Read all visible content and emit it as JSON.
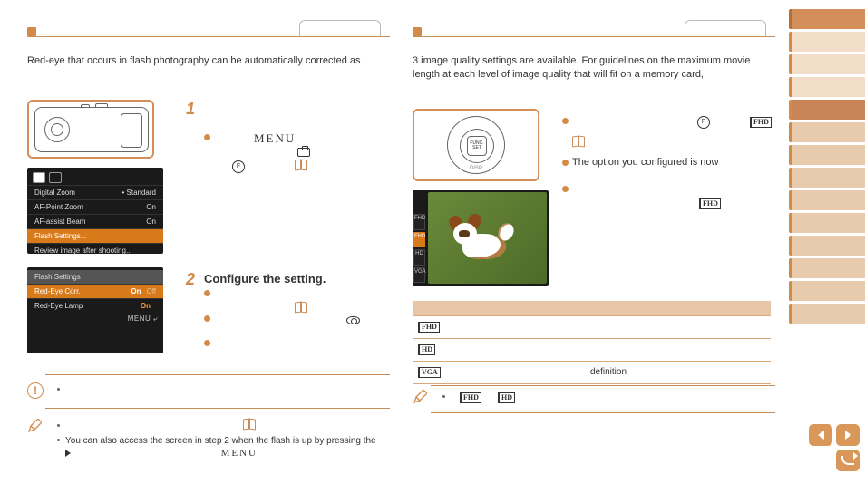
{
  "left": {
    "intro": "Red-eye that occurs in flash photography can be automatically corrected as",
    "menu_label": "MENU",
    "screen1": {
      "rows": [
        {
          "label": "Digital Zoom",
          "value": "• Standard"
        },
        {
          "label": "AF-Point Zoom",
          "value": "On"
        },
        {
          "label": "AF-assist Beam",
          "value": "On"
        },
        {
          "label": "Flash Settings...",
          "value": ""
        },
        {
          "label": "Review image after shooting...",
          "value": ""
        }
      ],
      "selected": 3
    },
    "screen2": {
      "title": "Flash Settings",
      "rows": [
        {
          "label": "Red-Eye Corr.",
          "on": "On",
          "off": "Off"
        },
        {
          "label": "Red-Eye Lamp",
          "on": "On",
          "off": ""
        }
      ],
      "selected": 0,
      "footer": "MENU ⤶"
    },
    "step2_heading": "Configure the setting.",
    "caution_mark": "!",
    "note_text": "You can also access the screen in step 2 when the flash is up by pressing the",
    "note_menu": "MENU"
  },
  "right": {
    "intro": "3 image quality settings are available. For guidelines on the maximum movie length at each level of image quality that will fit on a memory card,",
    "dial": {
      "top": "",
      "bottom": "DISP.",
      "center1": "FUNC.",
      "center2": "SET"
    },
    "configured_text": "The option you configured is now",
    "edge": [
      "FHD",
      "FHD",
      "HD",
      "VGA"
    ],
    "edge_selected": 1,
    "table": {
      "headers": [
        "",
        "",
        ""
      ],
      "rows": [
        {
          "icon": "FHD",
          "c2": "",
          "c3": ""
        },
        {
          "icon": "HD",
          "c2": "",
          "c3": ""
        },
        {
          "icon": "VGA",
          "c2": "",
          "c3": "definition"
        }
      ]
    }
  },
  "nav": {
    "prev": "prev",
    "next": "next",
    "return": "return"
  }
}
